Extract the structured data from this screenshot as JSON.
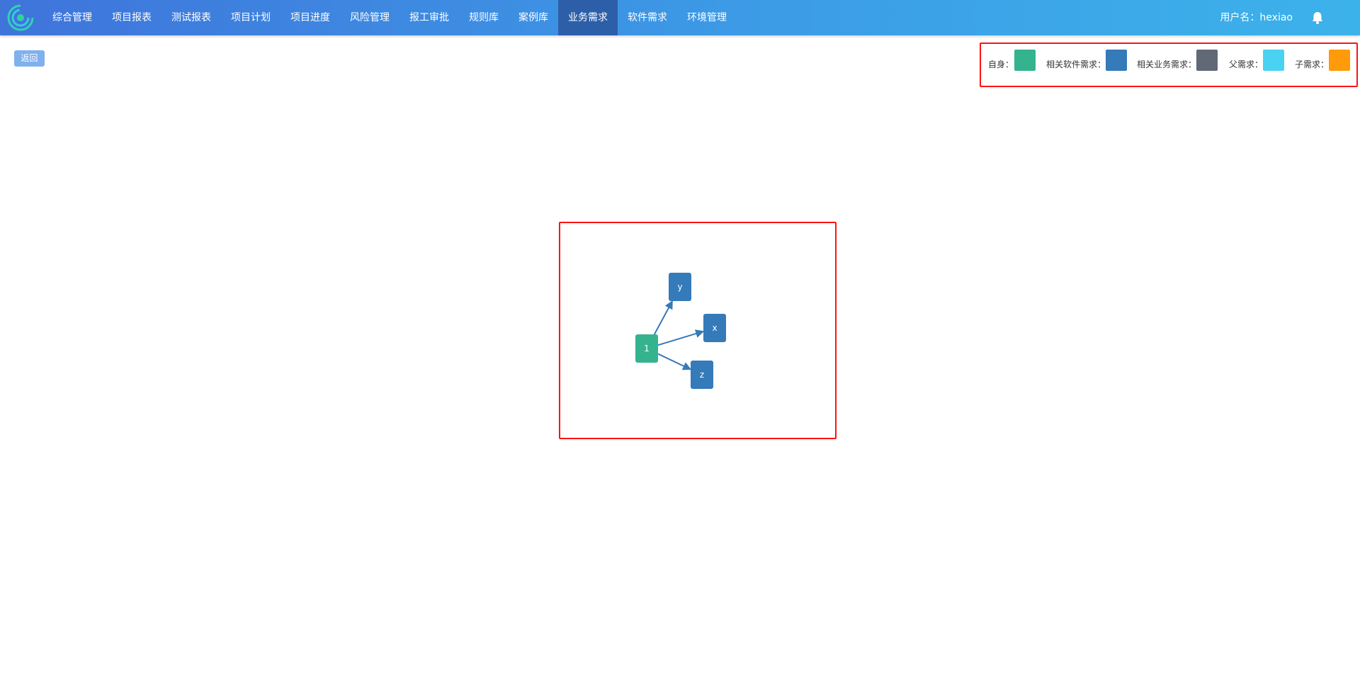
{
  "header": {
    "nav": [
      {
        "label": "综合管理",
        "active": false
      },
      {
        "label": "项目报表",
        "active": false
      },
      {
        "label": "测试报表",
        "active": false
      },
      {
        "label": "项目计划",
        "active": false
      },
      {
        "label": "项目进度",
        "active": false
      },
      {
        "label": "风险管理",
        "active": false
      },
      {
        "label": "报工审批",
        "active": false
      },
      {
        "label": "规则库",
        "active": false
      },
      {
        "label": "案例库",
        "active": false
      },
      {
        "label": "业务需求",
        "active": true
      },
      {
        "label": "软件需求",
        "active": false
      },
      {
        "label": "环境管理",
        "active": false
      }
    ],
    "user": "用户名：hexiao",
    "logo_icon": "spiral-logo-icon",
    "bell_icon": "bell-icon"
  },
  "back_button": "返回",
  "legend": [
    {
      "label": "自身：",
      "color": "#35b38f"
    },
    {
      "label": "相关软件需求：",
      "color": "#357ab9"
    },
    {
      "label": "相关业务需求：",
      "color": "#616876"
    },
    {
      "label": "父需求：",
      "color": "#4ad2f3"
    },
    {
      "label": "子需求：",
      "color": "#ff9a0b"
    }
  ],
  "graph": {
    "nodes": [
      {
        "id": "1",
        "label": "1",
        "kind": "自身"
      },
      {
        "id": "y",
        "label": "y",
        "kind": "相关软件需求"
      },
      {
        "id": "x",
        "label": "x",
        "kind": "相关软件需求"
      },
      {
        "id": "z",
        "label": "z",
        "kind": "相关软件需求"
      }
    ],
    "edges": [
      {
        "from": "1",
        "to": "y"
      },
      {
        "from": "1",
        "to": "x"
      },
      {
        "from": "1",
        "to": "z"
      }
    ],
    "edge_color": "#357ab9"
  }
}
